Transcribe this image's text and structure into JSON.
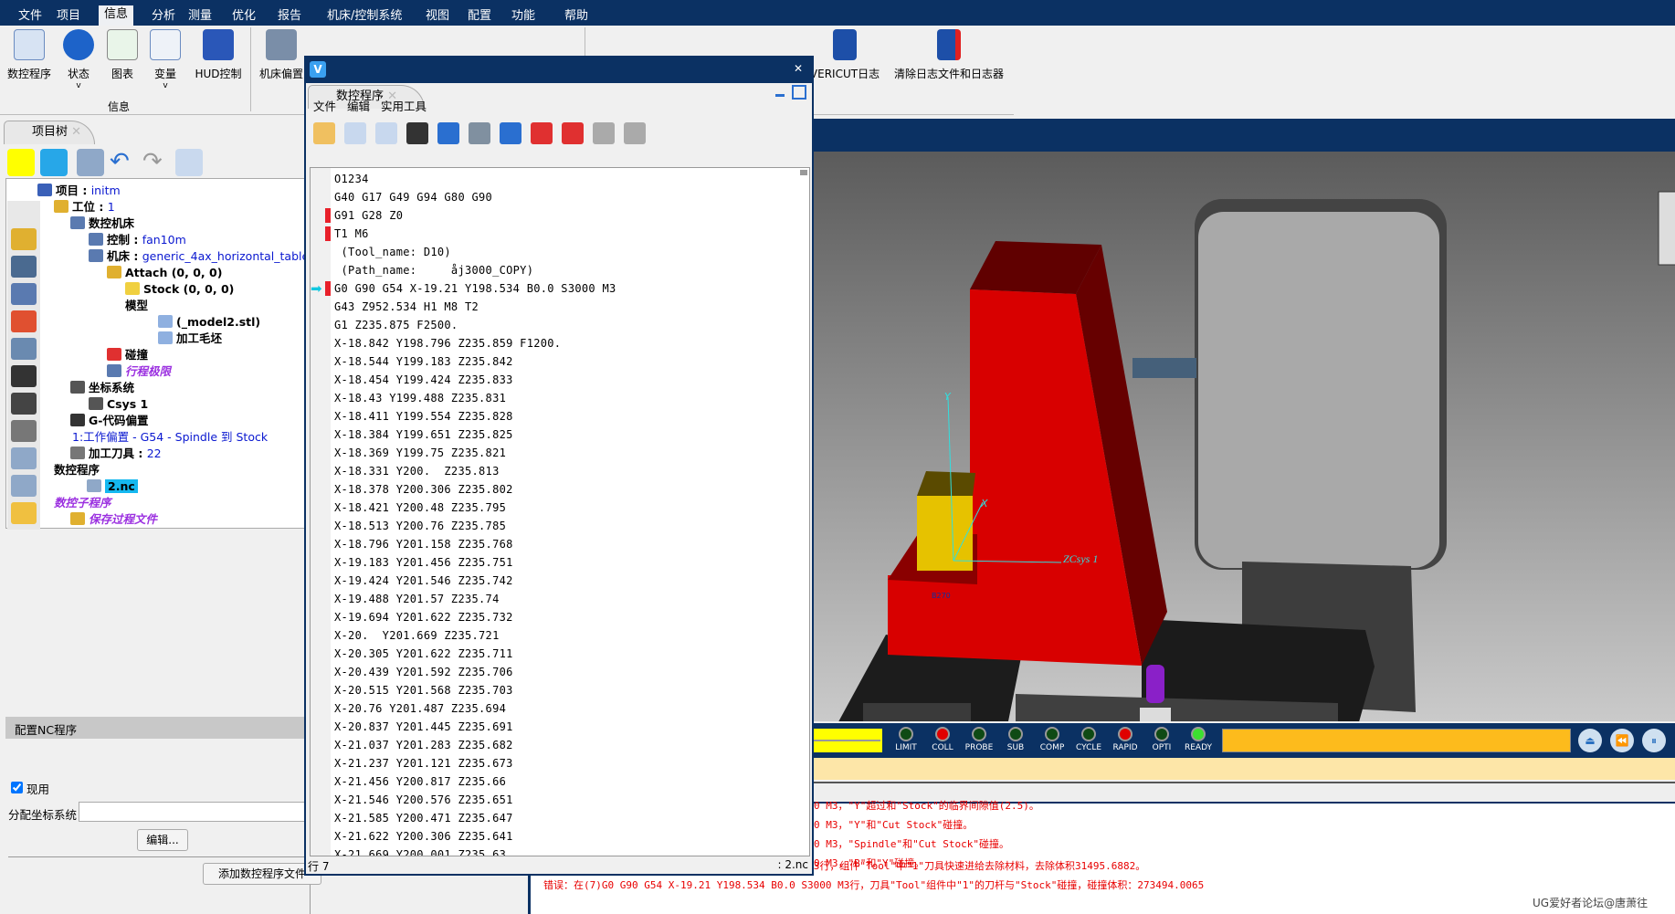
{
  "menubar": {
    "items": [
      "文件",
      "项目",
      "信息",
      "分析",
      "测量",
      "优化",
      "报告",
      "机床/控制系统",
      "视图",
      "配置",
      "功能",
      "帮助"
    ],
    "active": "信息"
  },
  "ribbon": {
    "info_group": {
      "label": "信息",
      "buttons": [
        {
          "label": "数控程序",
          "icon": "nc-program-icon"
        },
        {
          "label": "状态",
          "icon": "info-icon",
          "dropdown": true
        },
        {
          "label": "图表",
          "icon": "chart-icon"
        },
        {
          "label": "变量",
          "icon": "variables-icon",
          "dropdown": true
        },
        {
          "label": "HUD控制",
          "icon": "hud-icon"
        }
      ]
    },
    "machine_group": {
      "buttons": [
        {
          "label": "机床偏置",
          "icon": "machine-offset-icon"
        }
      ]
    },
    "log_group": {
      "buttons": [
        {
          "label": "VERICUT日志",
          "icon": "log-icon"
        },
        {
          "label": "清除日志文件和日志器",
          "icon": "clear-log-icon"
        }
      ]
    }
  },
  "project_tree": {
    "tab_label": "项目树",
    "items": [
      {
        "label": "项目 : ",
        "value": "initm"
      },
      {
        "label": "工位 : ",
        "value": "1"
      },
      {
        "label": "数控机床",
        "value": ""
      },
      {
        "label": "控制 : ",
        "value": "fan10m"
      },
      {
        "label": "机床 : ",
        "value": "generic_4ax_horizontal_table_b"
      },
      {
        "label": "Attach (0, 0, 0)",
        "value": ""
      },
      {
        "label": "Stock (0, 0, 0)",
        "value": ""
      },
      {
        "label": "模型",
        "value": ""
      },
      {
        "label": "(_model2.stl)",
        "value": ""
      },
      {
        "label": "加工毛坯",
        "value": ""
      },
      {
        "label": "碰撞",
        "value": ""
      },
      {
        "label": "行程极限",
        "value": ""
      },
      {
        "label": "坐标系统",
        "value": ""
      },
      {
        "label": "Csys 1",
        "value": ""
      },
      {
        "label": "G-代码偏置",
        "value": ""
      },
      {
        "label": "",
        "value": "1:工作偏置 - G54 - Spindle 到 Stock"
      },
      {
        "label": "加工刀具 : ",
        "value": "22"
      },
      {
        "label": "数控程序",
        "value": ""
      },
      {
        "label": "",
        "value": "2.nc",
        "selected": true
      },
      {
        "label": "数控子程序",
        "value": ""
      },
      {
        "label": "保存过程文件",
        "value": ""
      }
    ]
  },
  "config_nc": {
    "title": "配置NC程序",
    "active_label": "现用",
    "active_checked": true,
    "csys_label": "分配坐标系统",
    "csys_value": "",
    "edit_button": "编辑...",
    "add_button": "添加数控程序文件"
  },
  "nc_dialog": {
    "tab_label": "数控程序",
    "menu": [
      "文件",
      "编辑",
      "实用工具"
    ],
    "current_line_index": 6,
    "marked_lines": [
      2,
      3,
      6
    ],
    "lines": [
      "O1234",
      "G40 G17 G49 G94 G80 G90",
      "G91 G28 Z0",
      "T1 M6",
      " (Tool_name: D10)",
      " (Path_name:     åj3000_COPY)",
      "G0 G90 G54 X-19.21 Y198.534 B0.0 S3000 M3",
      "G43 Z952.534 H1 M8 T2",
      "G1 Z235.875 F2500.",
      "X-18.842 Y198.796 Z235.859 F1200.",
      "X-18.544 Y199.183 Z235.842",
      "X-18.454 Y199.424 Z235.833",
      "X-18.43 Y199.488 Z235.831",
      "X-18.411 Y199.554 Z235.828",
      "X-18.384 Y199.651 Z235.825",
      "X-18.369 Y199.75 Z235.821",
      "X-18.331 Y200.  Z235.813",
      "X-18.378 Y200.306 Z235.802",
      "X-18.421 Y200.48 Z235.795",
      "X-18.513 Y200.76 Z235.785",
      "X-18.796 Y201.158 Z235.768",
      "X-19.183 Y201.456 Z235.751",
      "X-19.424 Y201.546 Z235.742",
      "X-19.488 Y201.57 Z235.74",
      "X-19.694 Y201.622 Z235.732",
      "X-20.  Y201.669 Z235.721",
      "X-20.305 Y201.622 Z235.711",
      "X-20.439 Y201.592 Z235.706",
      "X-20.515 Y201.568 Z235.703",
      "X-20.76 Y201.487 Z235.694",
      "X-20.837 Y201.445 Z235.691",
      "X-21.037 Y201.283 Z235.682",
      "X-21.237 Y201.121 Z235.673",
      "X-21.456 Y200.817 Z235.66",
      "X-21.546 Y200.576 Z235.651",
      "X-21.585 Y200.471 Z235.647",
      "X-21.622 Y200.306 Z235.641",
      "X-21.669 Y200.001 Z235.63"
    ],
    "status_line": "行 7",
    "status_file": ": 2.nc"
  },
  "viewport": {
    "csys_label": "ZCsys 1",
    "axis_x": "X",
    "axis_y": "Y",
    "table_label": "B270"
  },
  "status_lights": [
    {
      "label": "LIMIT",
      "color": "#0f4a14"
    },
    {
      "label": "COLL",
      "color": "#e00000"
    },
    {
      "label": "PROBE",
      "color": "#0f4a14"
    },
    {
      "label": "SUB",
      "color": "#0f4a14"
    },
    {
      "label": "COMP",
      "color": "#0f4a14"
    },
    {
      "label": "CYCLE",
      "color": "#0f4a14"
    },
    {
      "label": "RAPID",
      "color": "#e00000"
    },
    {
      "label": "OPTI",
      "color": "#0f4a14"
    },
    {
      "label": "READY",
      "color": "#3ce030"
    }
  ],
  "log": {
    "lines": [
      "0 M3，\"Y\"超过和\"Stock\"的临界间隙值(2.5)。",
      "0 M3，\"Y\"和\"Cut Stock\"碰撞。",
      "0 M3，\"Spindle\"和\"Cut Stock\"碰撞。",
      "0 M3，\"B\"和\"Y\"碰撞。",
      "在(7)G0 G90 G54 X-19.21 Y198.534 B0.0 S3000 M3行，组件\"Tool\"中\"1\"刀具快速进给去除材料，去除体积31495.6882。",
      "错误：在(7)G0 G90 G54 X-19.21 Y198.534 B0.0 S3000 M3行，刀具\"Tool\"组件中\"1\"的刀杆与\"Stock\"碰撞，碰撞体积：273494.0065"
    ]
  },
  "watermark": "UG爱好者论坛@唐萧往"
}
